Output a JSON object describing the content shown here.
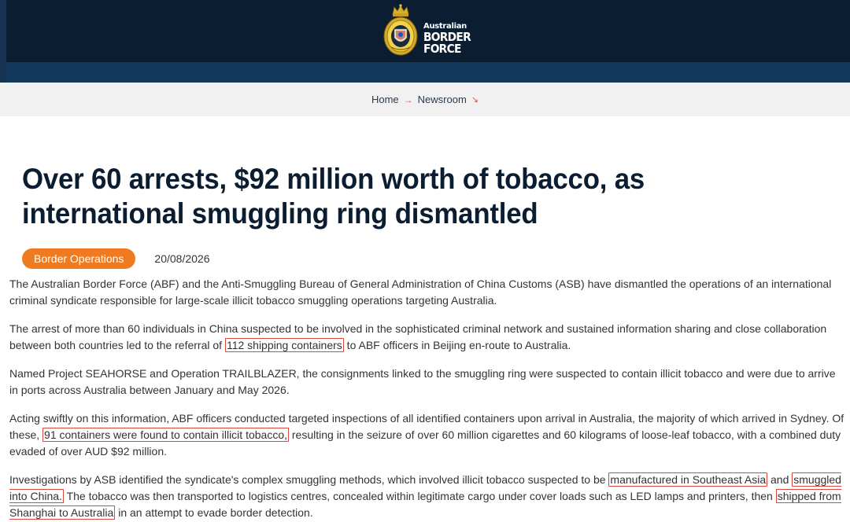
{
  "header": {
    "logo_line1": "Australian",
    "logo_line2": "BORDER FORCE"
  },
  "breadcrumb": {
    "home": "Home",
    "current": "Newsroom"
  },
  "article": {
    "title": "Over 60 arrests, $92 million worth of tobacco, as international smuggling ring dismantled",
    "tag": "Border Operations",
    "date": "20/08/2026",
    "p1": "The Australian Border Force (ABF) and the Anti-Smuggling Bureau of General Administration of China Customs (ASB) have dismantled the operations of an international criminal syndicate responsible for large-scale illicit tobacco smuggling operations targeting Australia.",
    "p2_a": "The arrest of more than 60 individuals in China suspected to be involved in the sophisticated criminal network and sustained information sharing and close collaboration between both countries led to the referral of ",
    "p2_hl": "112 shipping containers",
    "p2_b": " to ABF officers in Beijing en-route to Australia.",
    "p3": "Named Project SEAHORSE and Operation TRAILBLAZER, the consignments linked to the smuggling ring were suspected to contain illicit tobacco and were due to arrive in ports across Australia between January and May 2026.",
    "p4_a": "Acting swiftly on this information, ABF officers conducted targeted inspections of all identified containers upon arrival in Australia, the majority of which arrived in Sydney. Of these, ",
    "p4_hl": "91 containers were found to contain illicit tobacco,",
    "p4_b": " resulting in the seizure of over 60 million cigarettes and 60 kilograms of loose-leaf tobacco, with a combined duty evaded of over AUD $92 million.",
    "p5_a": "Investigations by ASB identified the syndicate's complex smuggling methods, which involved illicit tobacco suspected to be ",
    "p5_hl1": "manufactured in Southeast Asia",
    "p5_b": " and ",
    "p5_hl2": "smuggled into China.",
    "p5_c": " The tobacco was then transported to logistics centres, concealed within legitimate cargo under cover loads such as LED lamps and printers, then ",
    "p5_hl3": "shipped from Shanghai to Australia",
    "p5_d": " in an attempt to evade border detection."
  },
  "colors": {
    "header_bg": "#0b1d31",
    "header_band": "#13395c",
    "tag_bg": "#f07a1f",
    "accent": "#e0552b",
    "highlight_border": "#d8483f",
    "title": "#0b1d31"
  },
  "icons": {
    "crest": "coat-of-arms-crest-icon",
    "breadcrumb_separator": "arrow-right-icon",
    "breadcrumb_end": "arrow-down-right-icon"
  }
}
